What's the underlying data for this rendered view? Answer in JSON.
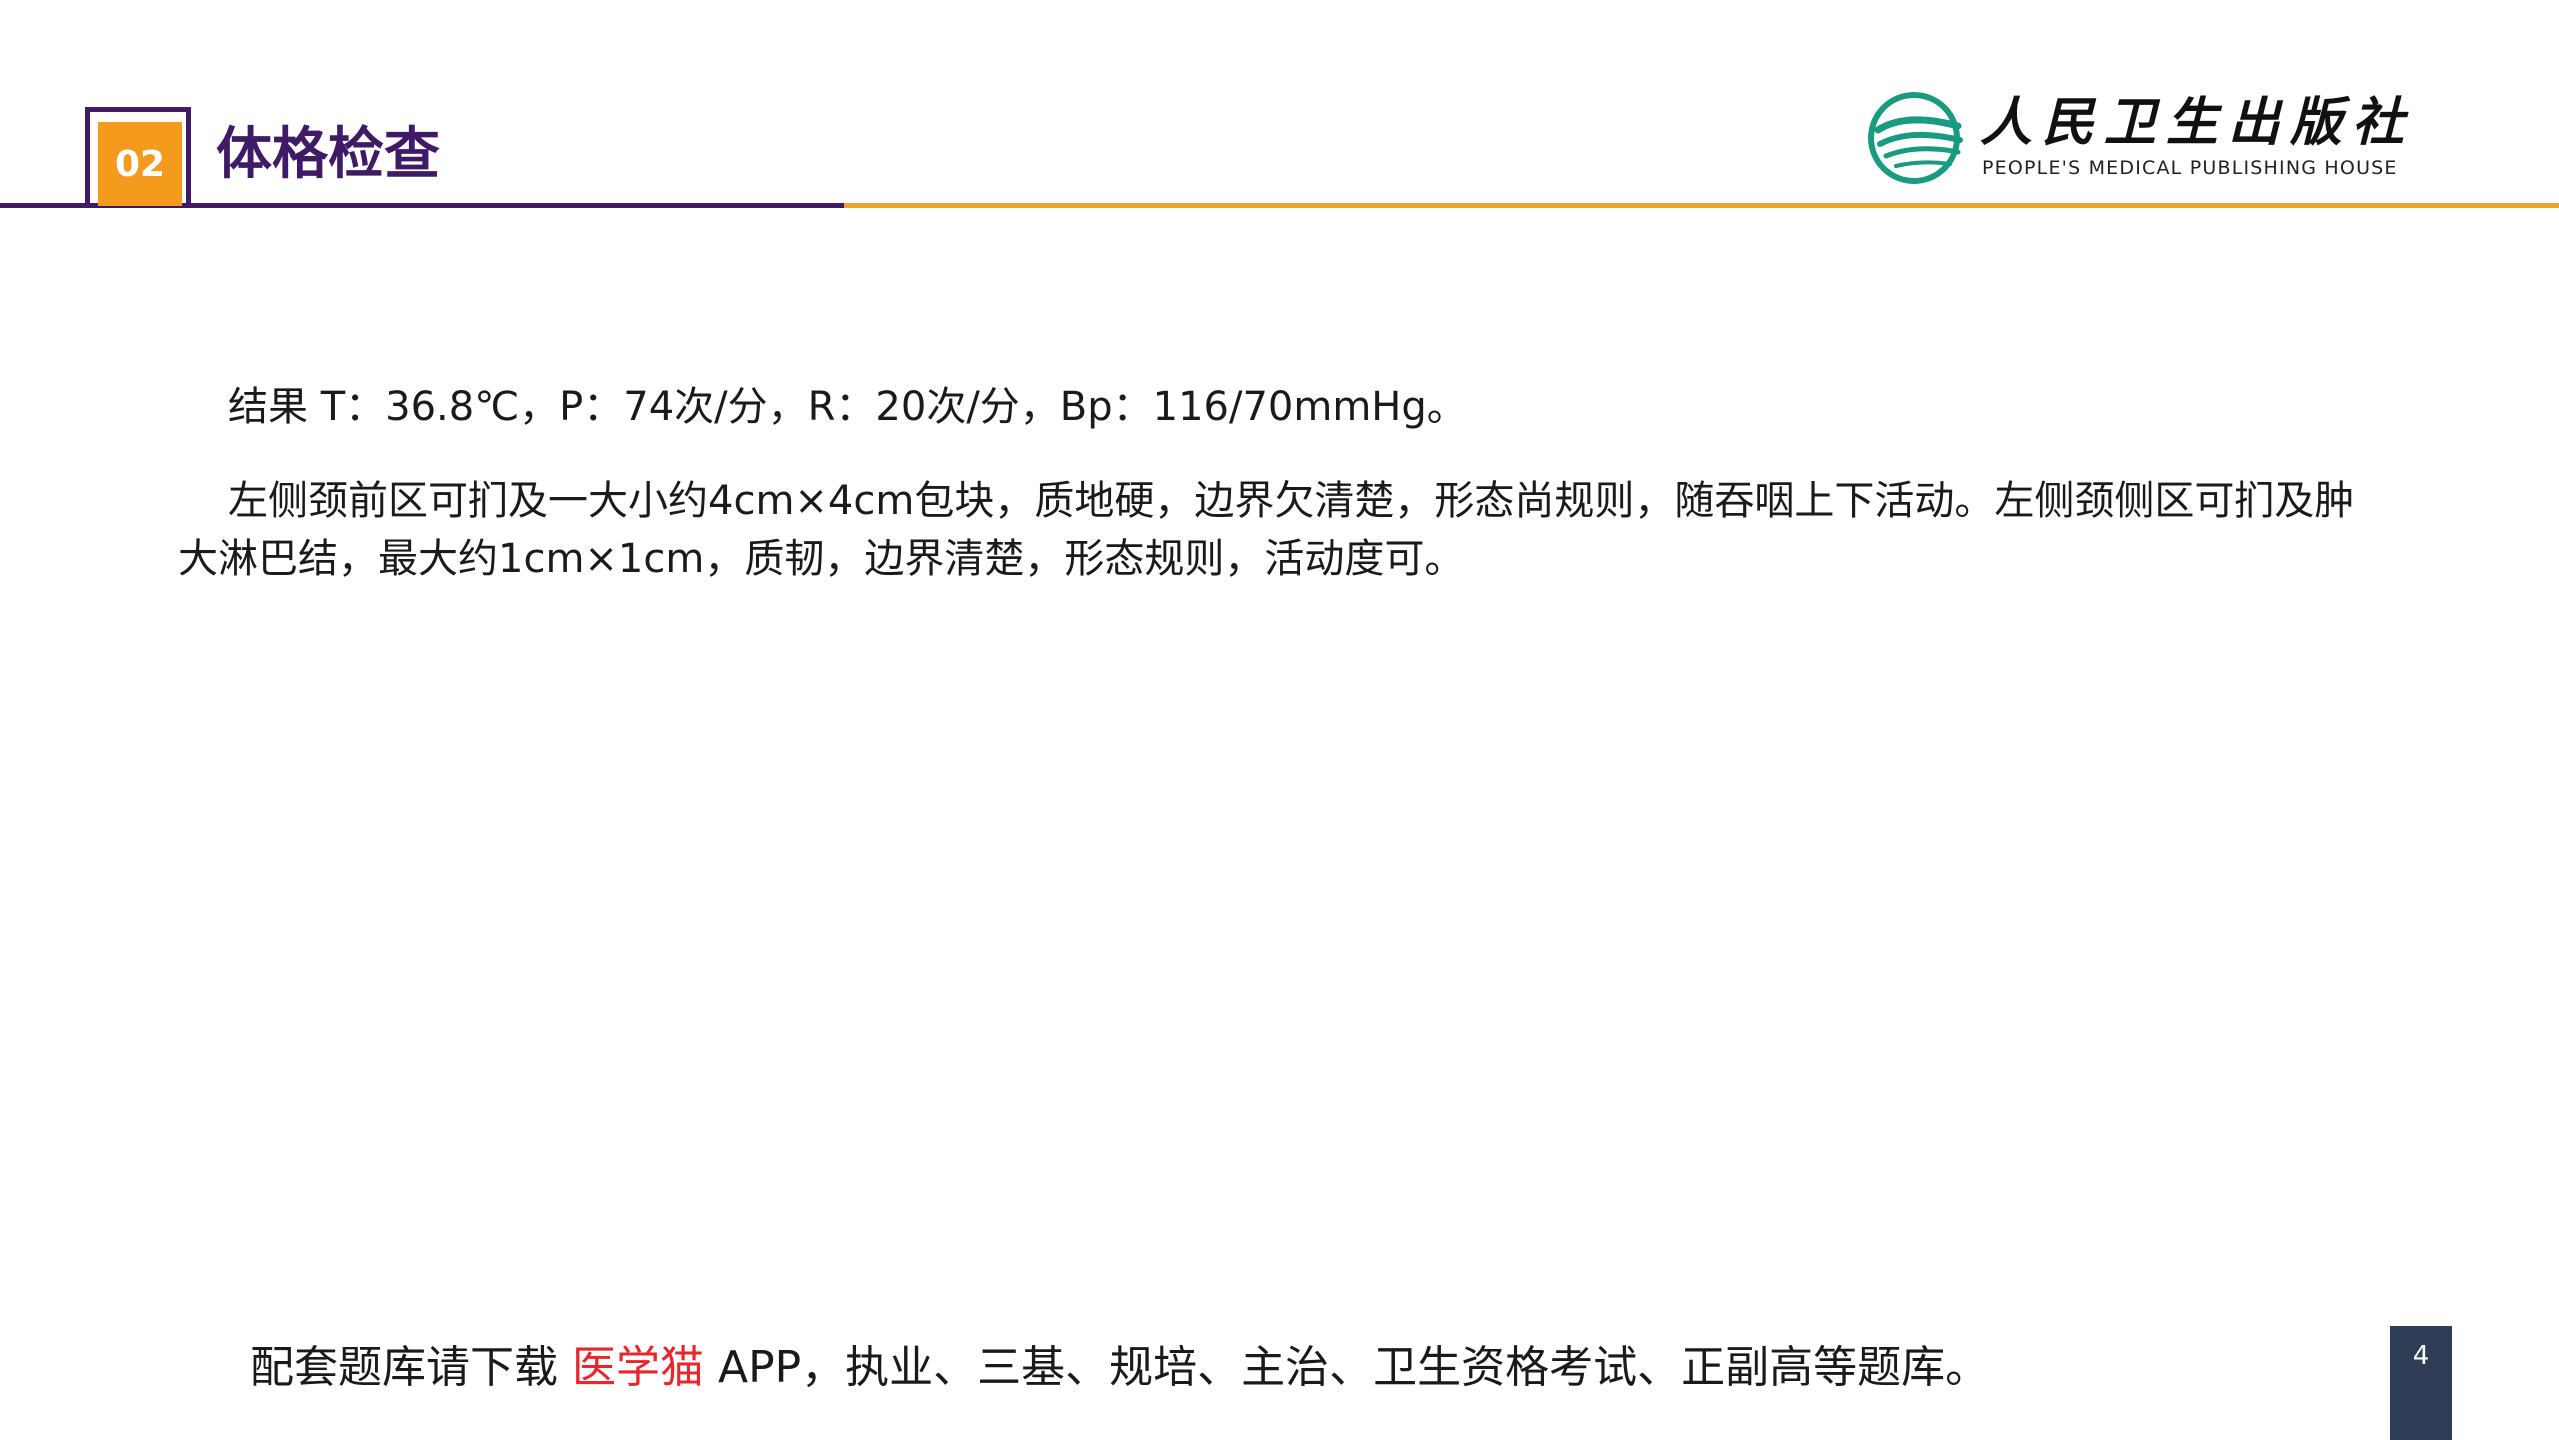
{
  "header": {
    "section_number": "02",
    "section_title": "体格检查",
    "colors": {
      "purple": "#3f1a66",
      "orange": "#f49b1e",
      "orange_line": "#f0a030"
    }
  },
  "logo": {
    "name_cn": "人民卫生出版社",
    "name_en": "PEOPLE'S MEDICAL PUBLISHING HOUSE",
    "emblem_icon": "pmph-emblem-icon",
    "emblem_color": "#1a9a80"
  },
  "content": {
    "paragraph_1": "结果 T：36.8℃，P：74次/分，R：20次/分，Bp：116/70mmHg。",
    "paragraph_2": "左侧颈前区可扪及一大小约4cm×4cm包块，质地硬，边界欠清楚，形态尚规则，随吞咽上下活动。左侧颈侧区可扪及肿大淋巴结，最大约1cm×1cm，质韧，边界清楚，形态规则，活动度可。"
  },
  "footer": {
    "prefix": "配套题库请下载 ",
    "app_name": "医学猫",
    "suffix": " APP，执业、三基、规培、主治、卫生资格考试、正副高等题库。",
    "highlight_color": "#e8262c"
  },
  "page_number": "4"
}
